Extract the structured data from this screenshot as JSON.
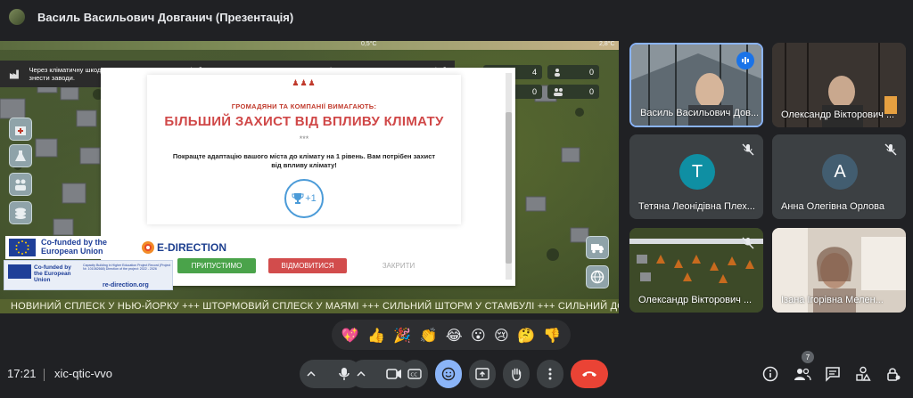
{
  "header": {
    "presenter_title": "Василь Васильович Довганич (Презентація)"
  },
  "stage": {
    "temp_labels": [
      "0,5°C",
      "2,8°C"
    ],
    "notice": "Через кліматичну шкоду вам доведеться закрити 1 фабрику, доки у вас знову не з'являться гроші. Ви також можете позичити гроші або знести заводи.",
    "stats": [
      "4",
      "0",
      "0",
      "0"
    ],
    "ticker": "НОВИНИЙ СПЛЕСК У НЬЮ-ЙОРКУ +++ ШТОРМОВИЙ СПЛЕСК У МАЯМІ +++ СИЛЬНИЙ ШТОРМ У СТАМБУЛІ +++ СИЛЬНИЙ ДОЩ У ВАРШАВ"
  },
  "dialog": {
    "kicker": "ГРОМАДЯНИ ТА КОМПАНІЇ ВИМАГАЮТЬ:",
    "heading": "БІЛЬШИЙ ЗАХИСТ ВІД ВПЛИВУ КЛІМАТУ",
    "dots": "***",
    "body": "Покращте адаптацію вашого міста до клімату на 1 рівень. Вам потрібен захист від впливу клімату!",
    "badge": "+1",
    "accept": "ПРИПУСТИМО",
    "decline": "ВІДМОВИТИСЯ",
    "close": "ЗАКРИТИ"
  },
  "logos": {
    "eu1": "Co-funded by the European Union",
    "edirection": "E-DIRECTION",
    "eu2": "Co-funded by the European Union",
    "eu2_small": "Capacity Building in Higher Education Project Record (Project Nr. 101082668) Direction of the project: 2022 - 2026",
    "url": "re-direction.org"
  },
  "participants": [
    {
      "name": "Василь Васильович Дов...",
      "initial": "",
      "color": ""
    },
    {
      "name": "Олександр Вікторович ...",
      "initial": "",
      "color": ""
    },
    {
      "name": "Тетяна Леонідівна Плех...",
      "initial": "T",
      "color": "#0f8fa3"
    },
    {
      "name": "Анна Олегівна Орлова",
      "initial": "A",
      "color": "#425d70"
    },
    {
      "name": "Олександр Вікторович ...",
      "initial": "",
      "color": ""
    },
    {
      "name": "Ізана Ігорівна Мелен...",
      "initial": "",
      "color": ""
    }
  ],
  "reactions": [
    "💖",
    "👍",
    "🎉",
    "👏",
    "😂",
    "😮",
    "😢",
    "🤔",
    "👎"
  ],
  "bottom": {
    "time": "17:21",
    "meeting_code": "xic-qtic-vvo",
    "participant_count": "7"
  }
}
